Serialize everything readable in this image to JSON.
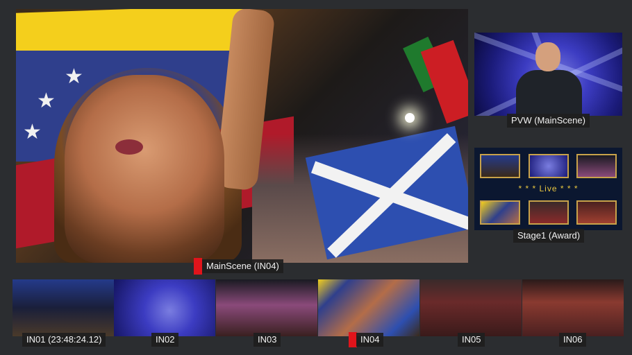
{
  "program": {
    "label": "MainScene (IN04)",
    "tally_color": "#e0141b"
  },
  "preview": {
    "label": "PVW (MainScene)"
  },
  "stage": {
    "label": "Stage1 (Award)",
    "overlay_text": "* * * Live * * *"
  },
  "inputs": [
    {
      "label": "IN01 (23:48:24.12)",
      "tally": false
    },
    {
      "label": "IN02",
      "tally": false
    },
    {
      "label": "IN03",
      "tally": false
    },
    {
      "label": "IN04",
      "tally": true
    },
    {
      "label": "IN05",
      "tally": false
    },
    {
      "label": "IN06",
      "tally": false
    }
  ],
  "colors": {
    "background": "#2b2d30",
    "tally": "#e0141b",
    "thumb_border": "#c8a24a",
    "live_text": "#e8c640"
  }
}
